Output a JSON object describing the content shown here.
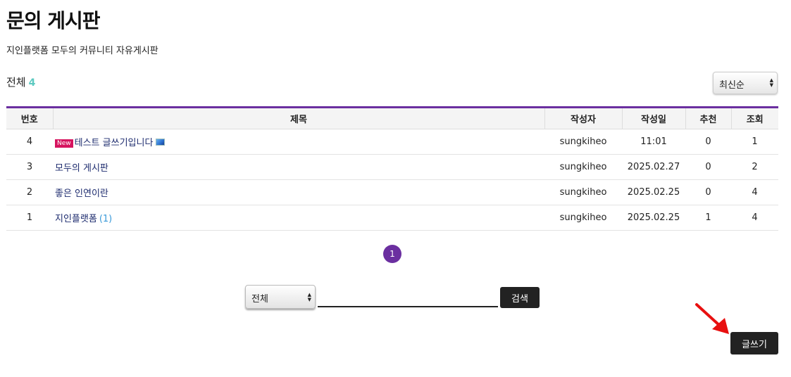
{
  "page": {
    "title": "문의 게시판",
    "description": "지인플랫폼 모두의 커뮤니티 자유게시판"
  },
  "summary": {
    "total_label": "전체",
    "total_count": "4"
  },
  "sort": {
    "selected": "최신순"
  },
  "table": {
    "headers": [
      "번호",
      "제목",
      "작성자",
      "작성일",
      "추천",
      "조회"
    ],
    "rows": [
      {
        "no": "4",
        "badge": "New",
        "title": "테스트 글쓰기입니다",
        "has_image": true,
        "comments": "",
        "author": "sungkiheo",
        "date": "11:01",
        "likes": "0",
        "views": "1"
      },
      {
        "no": "3",
        "badge": "",
        "title": "모두의 게시판",
        "has_image": false,
        "comments": "",
        "author": "sungkiheo",
        "date": "2025.02.27",
        "likes": "0",
        "views": "2"
      },
      {
        "no": "2",
        "badge": "",
        "title": "좋은 인연이란",
        "has_image": false,
        "comments": "",
        "author": "sungkiheo",
        "date": "2025.02.25",
        "likes": "0",
        "views": "4"
      },
      {
        "no": "1",
        "badge": "",
        "title": "지인플랫폼",
        "has_image": false,
        "comments": "(1)",
        "author": "sungkiheo",
        "date": "2025.02.25",
        "likes": "1",
        "views": "4"
      }
    ]
  },
  "pagination": {
    "current": "1"
  },
  "search": {
    "field_selected": "전체",
    "query": "",
    "button_label": "검색"
  },
  "actions": {
    "write_label": "글쓰기"
  },
  "icons": {
    "image_attachment": "image-icon",
    "select_arrows": "updown-arrows-icon",
    "annotation": "red-arrow-icon"
  },
  "colors": {
    "accent": "#6b2fa0",
    "new_badge": "#d6145f",
    "count": "#5cc9c0",
    "button": "#222222",
    "annotation_arrow": "#e81010"
  }
}
